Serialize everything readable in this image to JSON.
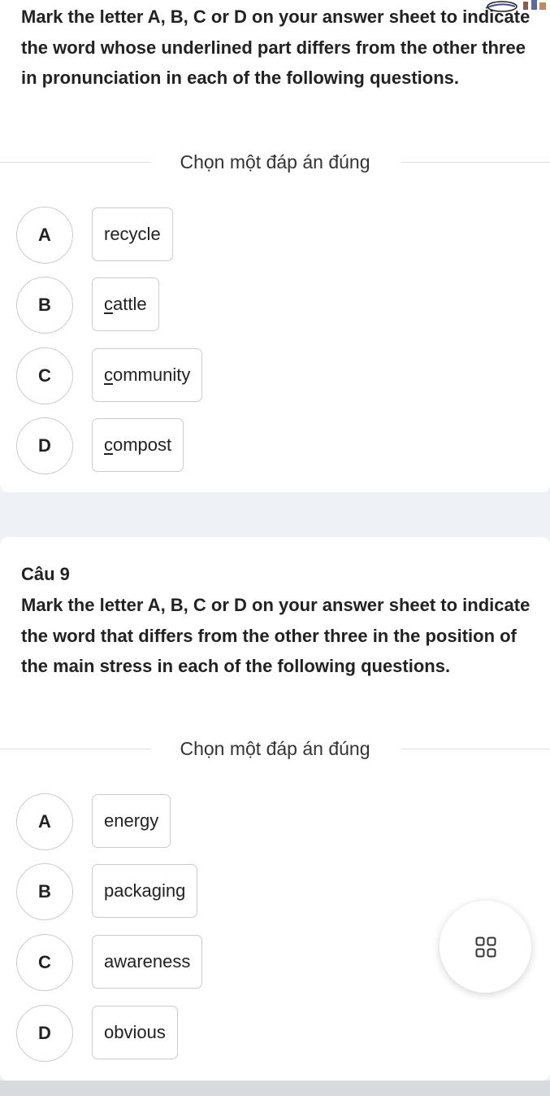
{
  "question_8": {
    "prompt": "Mark the letter A, B, C or D on your answer sheet to indicate the word whose underlined part differs from the other three in pronunciation in each of the following questions.",
    "instruction": "Chọn một đáp án đúng",
    "options": [
      {
        "letter": "A",
        "pre": "",
        "underlined": "",
        "post": "recycle"
      },
      {
        "letter": "B",
        "pre": "",
        "underlined": "c",
        "post": "attle"
      },
      {
        "letter": "C",
        "pre": "",
        "underlined": "c",
        "post": "ommunity"
      },
      {
        "letter": "D",
        "pre": "",
        "underlined": "c",
        "post": "ompost"
      }
    ]
  },
  "question_9": {
    "number": "Câu 9",
    "prompt": "Mark the letter A, B, C or D on your answer sheet to indicate the word that differs from the other three in the position of the main stress in each of the following questions.",
    "instruction": "Chọn một đáp án đúng",
    "options": [
      {
        "letter": "A",
        "text": "energy"
      },
      {
        "letter": "B",
        "text": "packaging"
      },
      {
        "letter": "C",
        "text": "awareness"
      },
      {
        "letter": "D",
        "text": "obvious"
      }
    ]
  },
  "icons": {
    "fab": "grid-icon",
    "corner": "decorative-doodle-icon"
  },
  "colors": {
    "background": "#eef1f5",
    "card": "#ffffff",
    "border": "#c9ccd1",
    "text": "#222222"
  }
}
